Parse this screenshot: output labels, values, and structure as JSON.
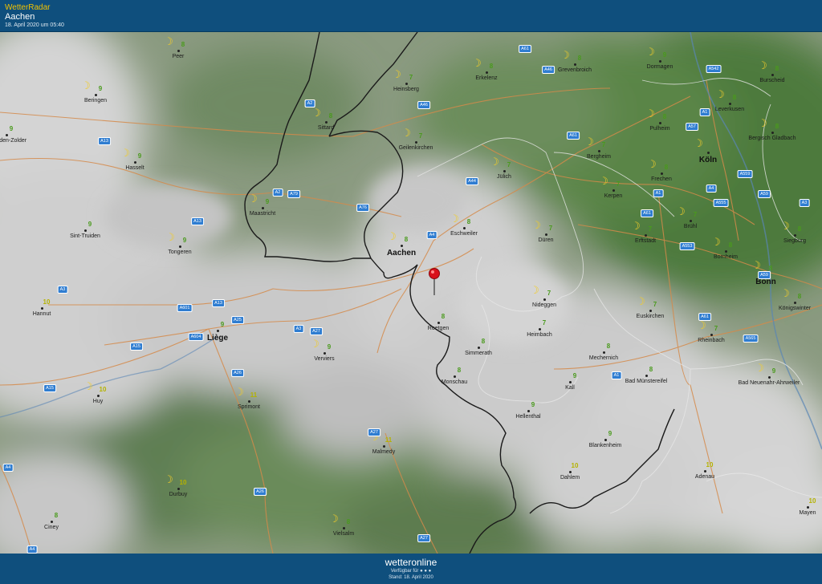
{
  "header": {
    "brand": "WetterRadar",
    "place": "Aachen",
    "date": "18. April 2020 um 05:40"
  },
  "footer": {
    "logo": "wetteronline",
    "available": "Verfügbar für ● ● ●",
    "stand": "Stand: 18. April 2020"
  },
  "colors": {
    "header_bg": "#0f4f7d",
    "temp_green": "#4a9a1d",
    "temp_yellow": "#b4b200",
    "moon": "#f1cc2a",
    "motorway_badge": "#2f7dd1"
  },
  "cities": [
    {
      "name": "Peer",
      "temp": "8",
      "moon": true
    },
    {
      "name": "Beringen",
      "temp": "9",
      "moon": true
    },
    {
      "name": "Heusden-Zolder",
      "temp": "9",
      "moon": false
    },
    {
      "name": "Hasselt",
      "temp": "9",
      "moon": true
    },
    {
      "name": "Sint-Truiden",
      "temp": "9",
      "moon": false
    },
    {
      "name": "Tongeren",
      "temp": "9",
      "moon": true
    },
    {
      "name": "Hannut",
      "temp": "10",
      "moon": false
    },
    {
      "name": "Liège",
      "temp": "9",
      "moon": false
    },
    {
      "name": "Huy",
      "temp": "10",
      "moon": true
    },
    {
      "name": "Ciney",
      "temp": "8",
      "moon": false
    },
    {
      "name": "Durbuy",
      "temp": "10",
      "moon": true
    },
    {
      "name": "Sprimont",
      "temp": "11",
      "moon": true
    },
    {
      "name": "Verviers",
      "temp": "9",
      "moon": true
    },
    {
      "name": "Malmedy",
      "temp": "11",
      "moon": true
    },
    {
      "name": "Vielsalm",
      "temp": "8",
      "moon": true
    },
    {
      "name": "Maastricht",
      "temp": "9",
      "moon": true
    },
    {
      "name": "Sittard",
      "temp": "8",
      "moon": true
    },
    {
      "name": "Heinsberg",
      "temp": "7",
      "moon": true
    },
    {
      "name": "Geilenkirchen",
      "temp": "7",
      "moon": true
    },
    {
      "name": "Aachen",
      "temp": "8",
      "moon": true
    },
    {
      "name": "Eschweiler",
      "temp": "8",
      "moon": true
    },
    {
      "name": "Erkelenz",
      "temp": "8",
      "moon": true
    },
    {
      "name": "Jülich",
      "temp": "7",
      "moon": true
    },
    {
      "name": "Düren",
      "temp": "7",
      "moon": true
    },
    {
      "name": "Roetgen",
      "temp": "8",
      "moon": false
    },
    {
      "name": "Simmerath",
      "temp": "8",
      "moon": false
    },
    {
      "name": "Monschau",
      "temp": "8",
      "moon": false
    },
    {
      "name": "Nideggen",
      "temp": "7",
      "moon": true
    },
    {
      "name": "Heimbach",
      "temp": "7",
      "moon": false
    },
    {
      "name": "Hellenthal",
      "temp": "9",
      "moon": false
    },
    {
      "name": "Dahlem",
      "temp": "10",
      "moon": false
    },
    {
      "name": "Blankenheim",
      "temp": "9",
      "moon": false
    },
    {
      "name": "Kall",
      "temp": "9",
      "moon": false
    },
    {
      "name": "Mechernich",
      "temp": "8",
      "moon": false
    },
    {
      "name": "Bad Münstereifel",
      "temp": "8",
      "moon": false
    },
    {
      "name": "Grevenbroich",
      "temp": "8",
      "moon": true
    },
    {
      "name": "Dormagen",
      "temp": "9",
      "moon": true
    },
    {
      "name": "Burscheid",
      "temp": "8",
      "moon": true
    },
    {
      "name": "Leverkusen",
      "temp": "8",
      "moon": true
    },
    {
      "name": "Pulheim",
      "temp": "8",
      "moon": true
    },
    {
      "name": "Bergheim",
      "temp": "7",
      "moon": true
    },
    {
      "name": "Köln",
      "temp": "",
      "moon": true
    },
    {
      "name": "Bergisch Gladbach",
      "temp": "8",
      "moon": true
    },
    {
      "name": "Frechen",
      "temp": "8",
      "moon": true
    },
    {
      "name": "Kerpen",
      "temp": "7",
      "moon": true
    },
    {
      "name": "Erftstadt",
      "temp": "7",
      "moon": true
    },
    {
      "name": "Brühl",
      "temp": "7",
      "moon": true
    },
    {
      "name": "Bornheim",
      "temp": "8",
      "moon": true
    },
    {
      "name": "Siegburg",
      "temp": "8",
      "moon": true
    },
    {
      "name": "Bonn",
      "temp": "8",
      "moon": true
    },
    {
      "name": "Königswinter",
      "temp": "8",
      "moon": true
    },
    {
      "name": "Euskirchen",
      "temp": "7",
      "moon": true
    },
    {
      "name": "Rheinbach",
      "temp": "7",
      "moon": true
    },
    {
      "name": "Bad Neuenahr-Ahrweiler",
      "temp": "9",
      "moon": true
    },
    {
      "name": "Adenau",
      "temp": "10",
      "moon": false
    },
    {
      "name": "Mayen",
      "temp": "10",
      "moon": false
    }
  ],
  "motorways": [
    "A61",
    "A46",
    "A542",
    "A2",
    "A46",
    "A1",
    "A57",
    "A61",
    "A44",
    "A4",
    "A559",
    "A555",
    "A59",
    "A3",
    "A4",
    "A61",
    "A553",
    "A59",
    "A1",
    "A61",
    "A565",
    "A1",
    "A2",
    "A13",
    "A2",
    "A79",
    "A76",
    "A13",
    "A3",
    "A601",
    "A13",
    "A25",
    "A3",
    "A27",
    "A604",
    "A15",
    "A26",
    "A15",
    "A26",
    "A27",
    "A4",
    "A26",
    "A27",
    "A4"
  ]
}
